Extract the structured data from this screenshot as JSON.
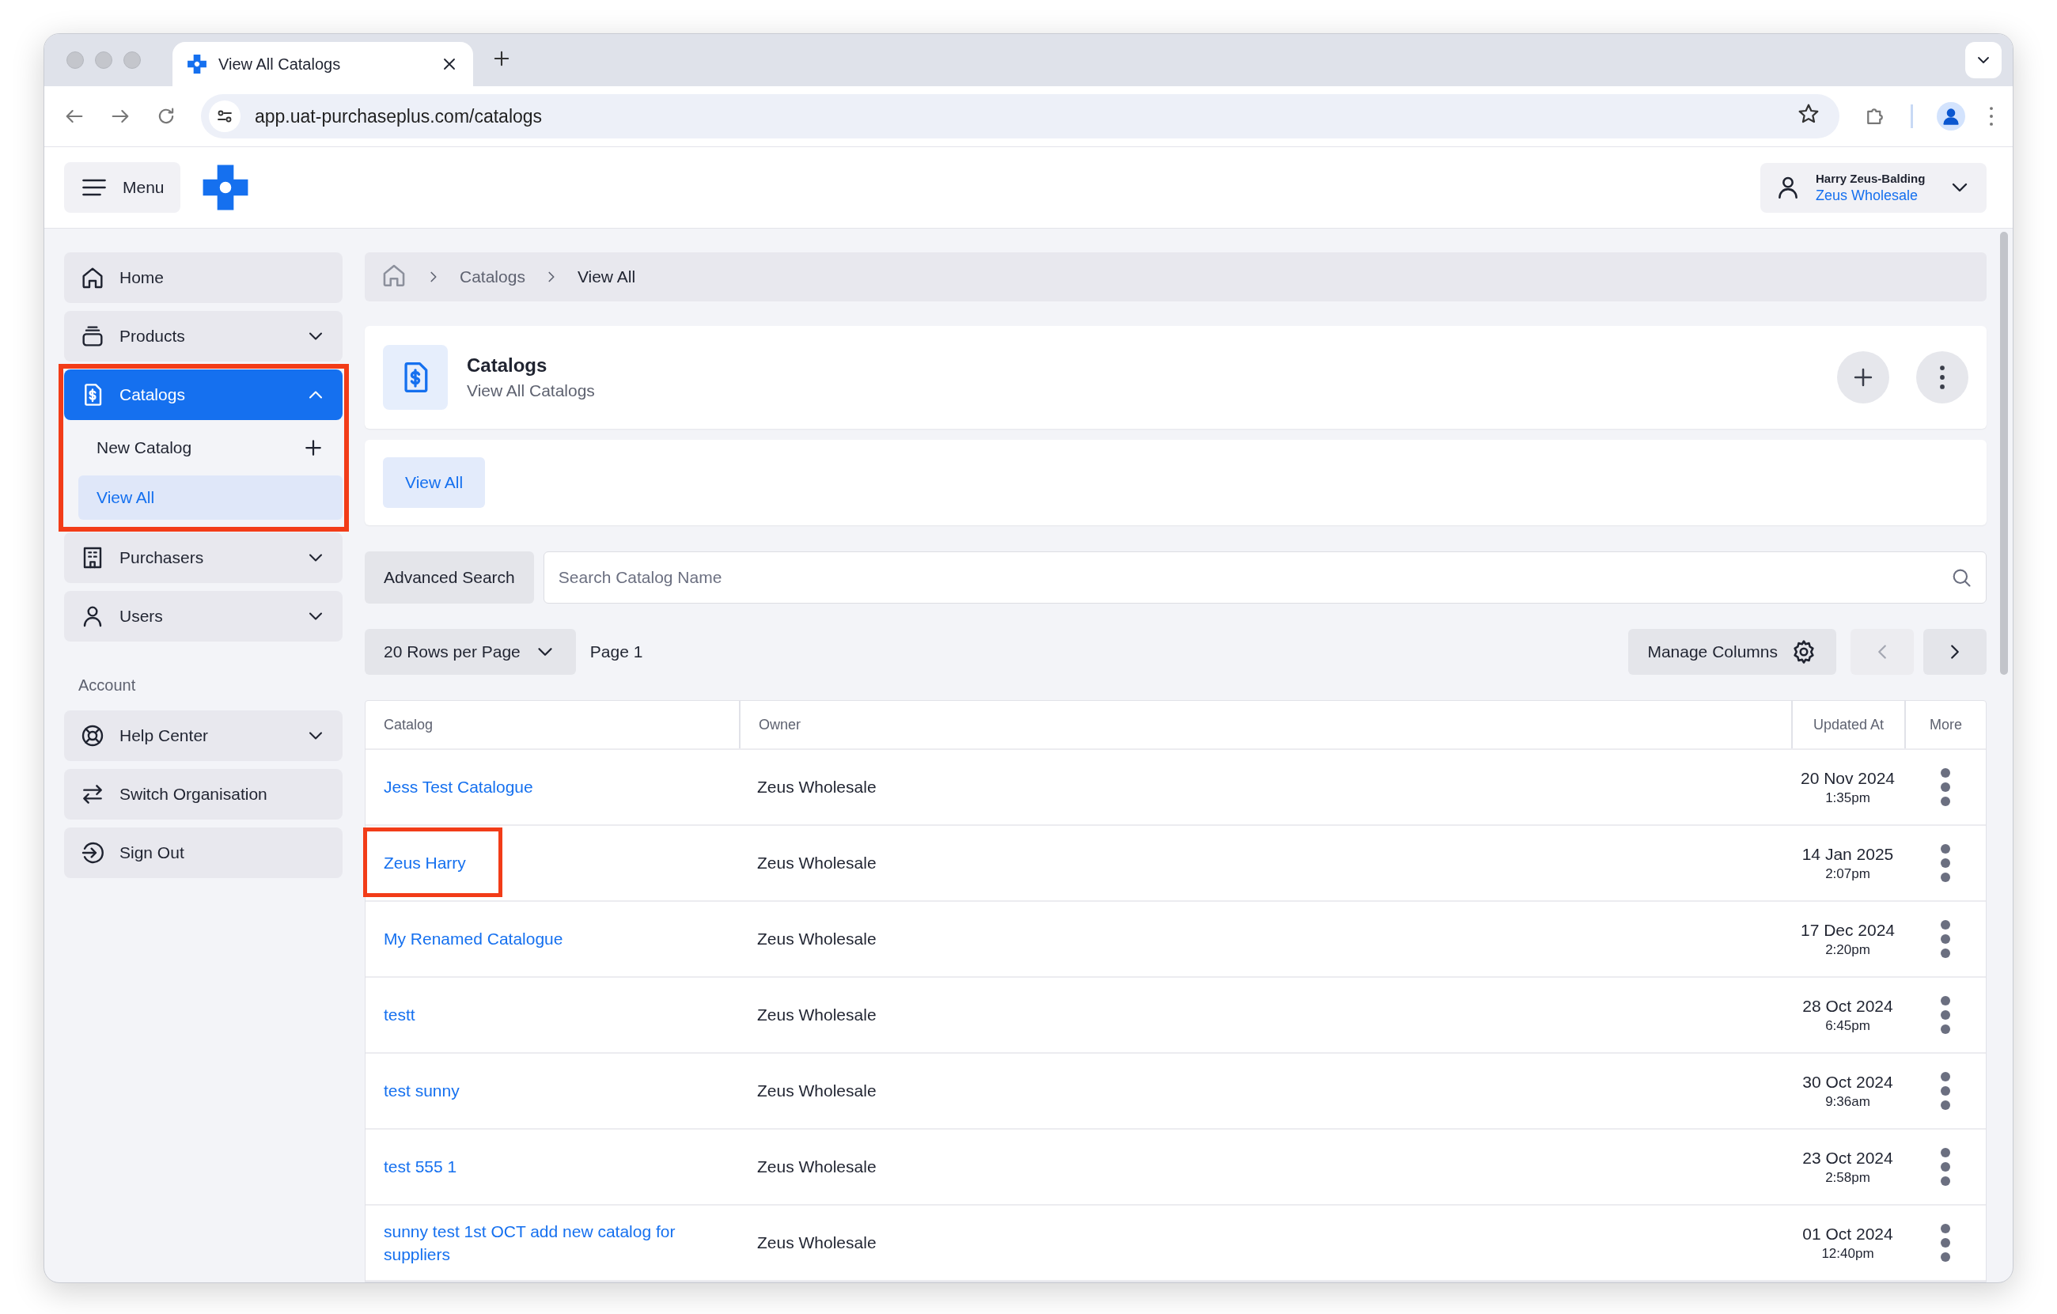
{
  "browser": {
    "tab_title": "View All Catalogs",
    "url": "app.uat-purchaseplus.com/catalogs"
  },
  "header": {
    "menu_label": "Menu",
    "user": {
      "name": "Harry Zeus-Balding",
      "organisation": "Zeus Wholesale"
    }
  },
  "sidebar": {
    "items": [
      {
        "label": "Home",
        "kind": "home",
        "selected": false,
        "highlighted": false
      },
      {
        "label": "Products",
        "kind": "products",
        "selected": false,
        "expanded": false,
        "highlighted": false
      },
      {
        "label": "Catalogs",
        "kind": "catalog",
        "selected": true,
        "expanded": true,
        "highlighted": true,
        "children": [
          {
            "label": "New Catalog",
            "kind": "add",
            "selected": false
          },
          {
            "label": "View All",
            "kind": "link",
            "selected": true
          }
        ]
      },
      {
        "label": "Purchasers",
        "kind": "building",
        "selected": false,
        "expanded": false,
        "highlighted": false
      },
      {
        "label": "Users",
        "kind": "user",
        "selected": false,
        "expanded": false,
        "highlighted": false
      }
    ],
    "account": {
      "heading": "Account",
      "items": [
        {
          "label": "Help Center",
          "kind": "help",
          "selected": false,
          "expanded": false,
          "highlighted": false
        },
        {
          "label": "Switch Organisation",
          "kind": "switch",
          "selected": false,
          "highlighted": false
        },
        {
          "label": "Sign Out",
          "kind": "signout",
          "selected": false,
          "highlighted": false
        }
      ]
    }
  },
  "breadcrumb": [
    "Catalogs",
    "View All"
  ],
  "page_header": {
    "title": "Catalogs",
    "subtitle": "View All Catalogs"
  },
  "tabs": [
    {
      "label": "View All",
      "selected": true
    }
  ],
  "search": {
    "advanced_label": "Advanced Search",
    "placeholder": "Search Catalog Name"
  },
  "pagination": {
    "rows_per_page": "20 Rows per Page",
    "page": "Page 1",
    "manage_columns": "Manage Columns",
    "previous_disabled": true,
    "next_disabled": false
  },
  "table": {
    "columns": [
      "Catalog",
      "Owner",
      "Updated At",
      "More"
    ],
    "rows": [
      {
        "catalog": "Jess Test Catalogue",
        "owner": "Zeus Wholesale",
        "date": "20 Nov 2024",
        "time": "1:35pm",
        "highlighted": false
      },
      {
        "catalog": "Zeus Harry",
        "owner": "Zeus Wholesale",
        "date": "14 Jan 2025",
        "time": "2:07pm",
        "highlighted": true
      },
      {
        "catalog": "My Renamed Catalogue",
        "owner": "Zeus Wholesale",
        "date": "17 Dec 2024",
        "time": "2:20pm",
        "highlighted": false
      },
      {
        "catalog": "testt",
        "owner": "Zeus Wholesale",
        "date": "28 Oct 2024",
        "time": "6:45pm",
        "highlighted": false
      },
      {
        "catalog": "test sunny",
        "owner": "Zeus Wholesale",
        "date": "30 Oct 2024",
        "time": "9:36am",
        "highlighted": false
      },
      {
        "catalog": "test 555 1",
        "owner": "Zeus Wholesale",
        "date": "23 Oct 2024",
        "time": "2:58pm",
        "highlighted": false
      },
      {
        "catalog": "sunny test 1st OCT add new catalog for suppliers",
        "owner": "Zeus Wholesale",
        "date": "01 Oct 2024",
        "time": "12:40pm",
        "highlighted": false
      }
    ]
  }
}
